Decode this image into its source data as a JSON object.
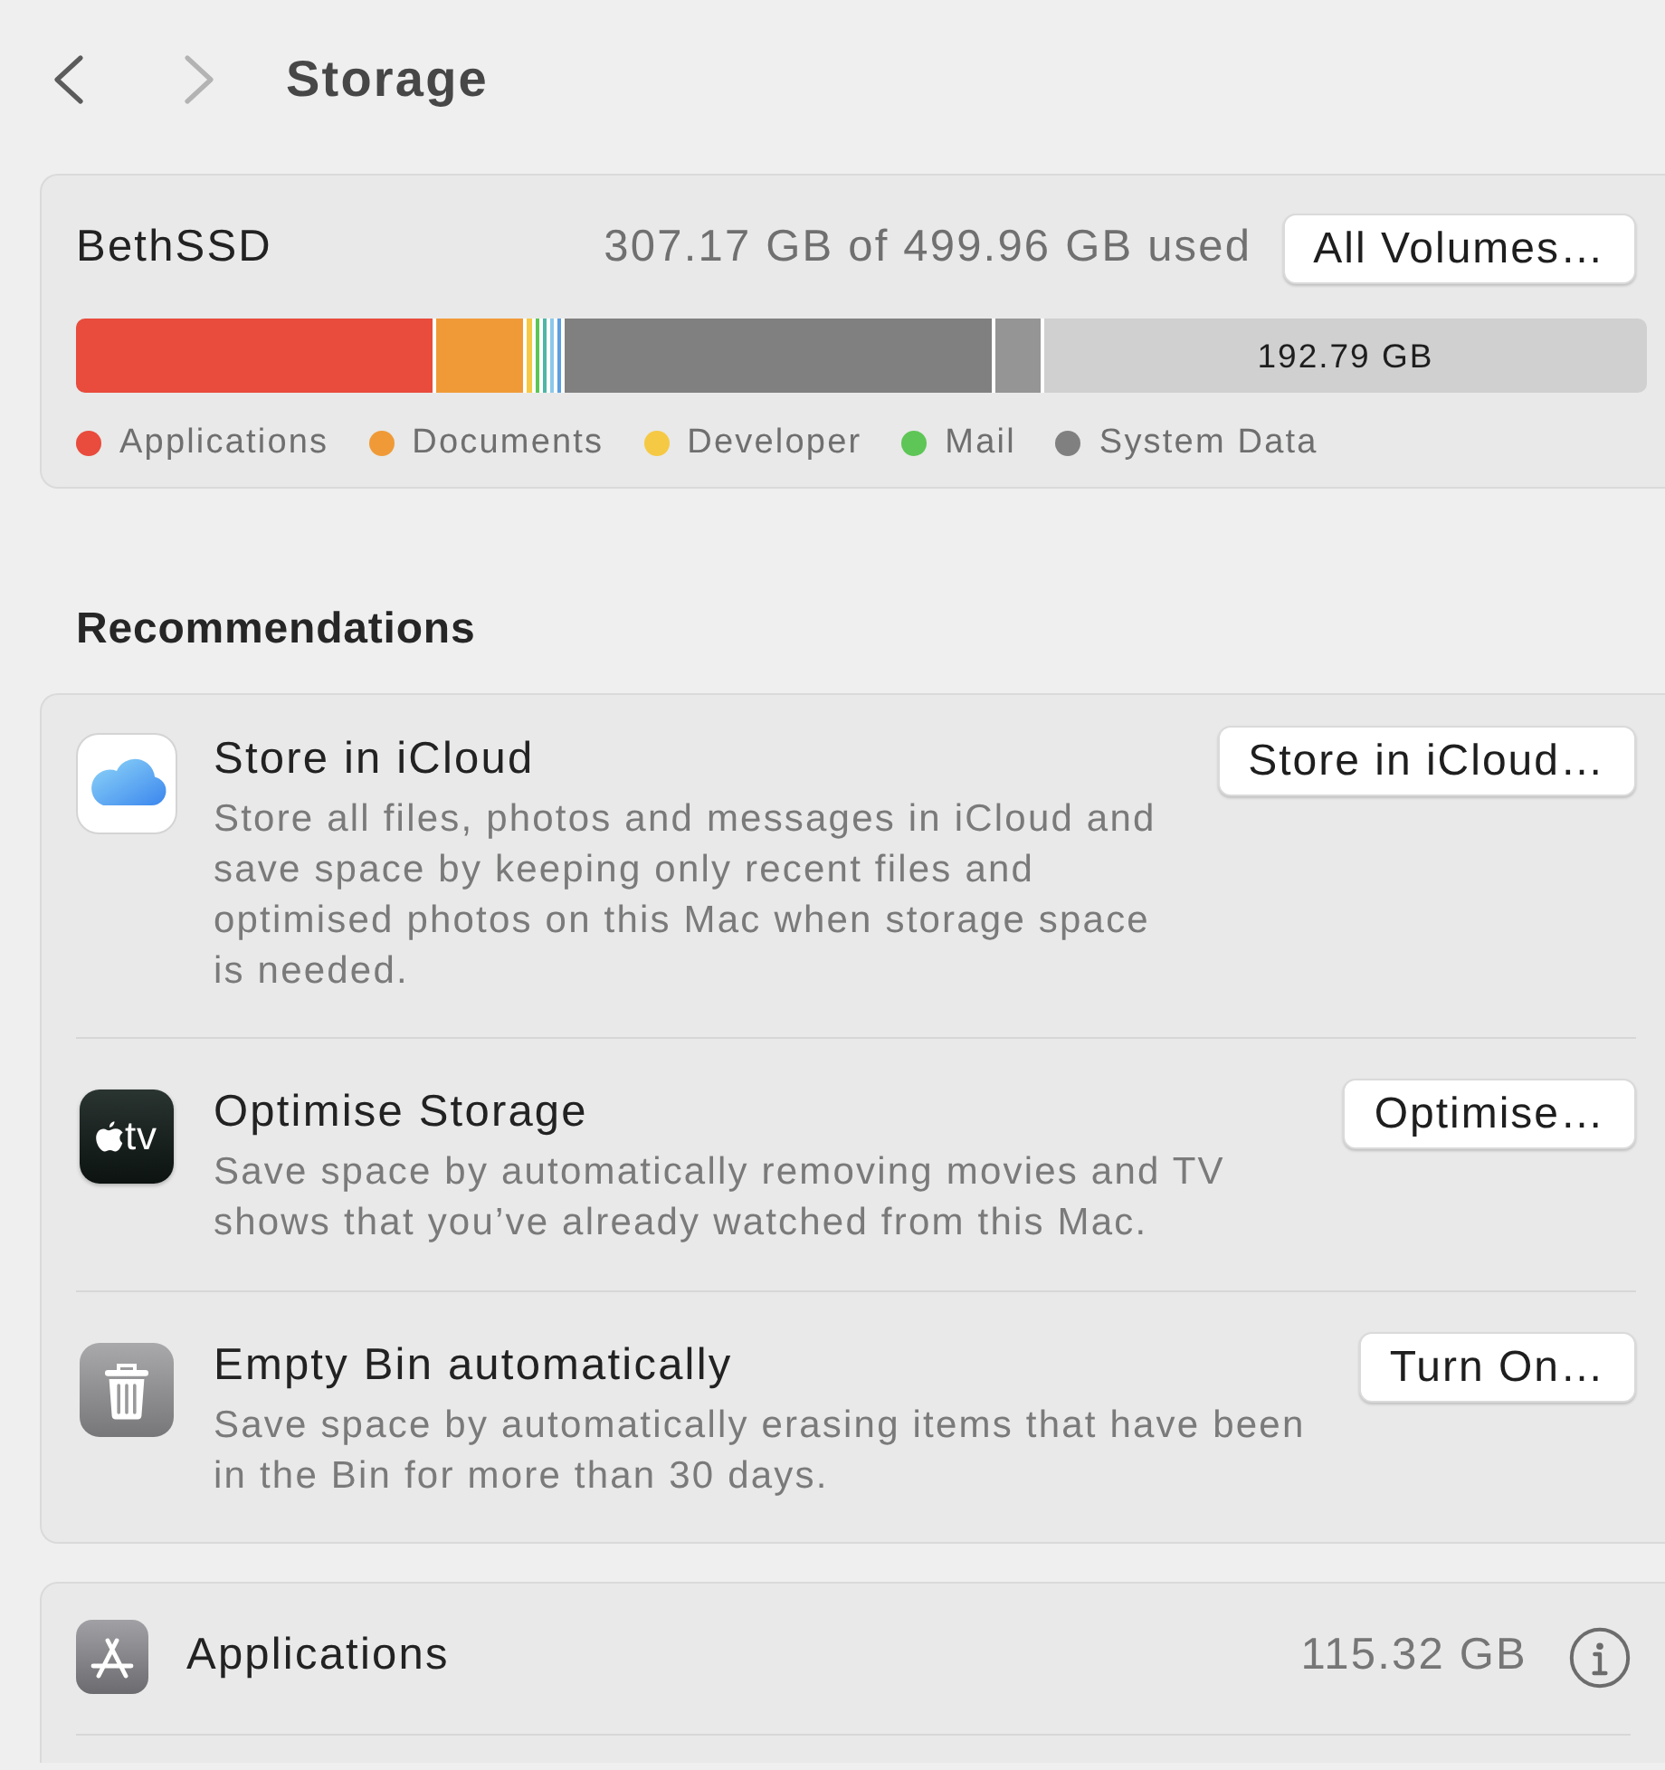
{
  "toolbar": {
    "back_button": {
      "disabled": false
    },
    "forward_button": {
      "disabled": true
    },
    "title": "Storage"
  },
  "disk": {
    "name": "BethSSD",
    "usage": "307.17 GB of 499.96 GB used",
    "button": "All Volumes…",
    "usage_bar": {
      "free_label": "192.79 GB"
    },
    "legend": [
      {
        "label": "Applications",
        "color": "#e94b3c"
      },
      {
        "label": "Documents",
        "color": "#f09a37"
      },
      {
        "label": "Developer",
        "color": "#f6c944"
      },
      {
        "label": "Mail",
        "color": "#5dc656"
      },
      {
        "label": "System Data",
        "color": "#808080"
      }
    ]
  },
  "recommendations": {
    "heading": "Recommendations",
    "items": [
      {
        "kind": "icloud",
        "title": "Store in iCloud",
        "description": "Store all files, photos and messages in iCloud and save space by keeping only recent files and optimised photos on this Mac when storage space is needed.",
        "button": "Store in iCloud…"
      },
      {
        "kind": "tv",
        "icon_text": "tv",
        "title": "Optimise Storage",
        "description": "Save space by automatically removing movies and TV shows that you’ve already watched from this Mac.",
        "button": "Optimise…"
      },
      {
        "kind": "bin",
        "title": "Empty Bin automatically",
        "description": "Save space by automatically erasing items that have been in the Bin for more than 30 days.",
        "button": "Turn On…"
      }
    ]
  },
  "categories": [
    {
      "kind": "applications",
      "name": "Applications",
      "size": "115.32 GB"
    }
  ]
}
